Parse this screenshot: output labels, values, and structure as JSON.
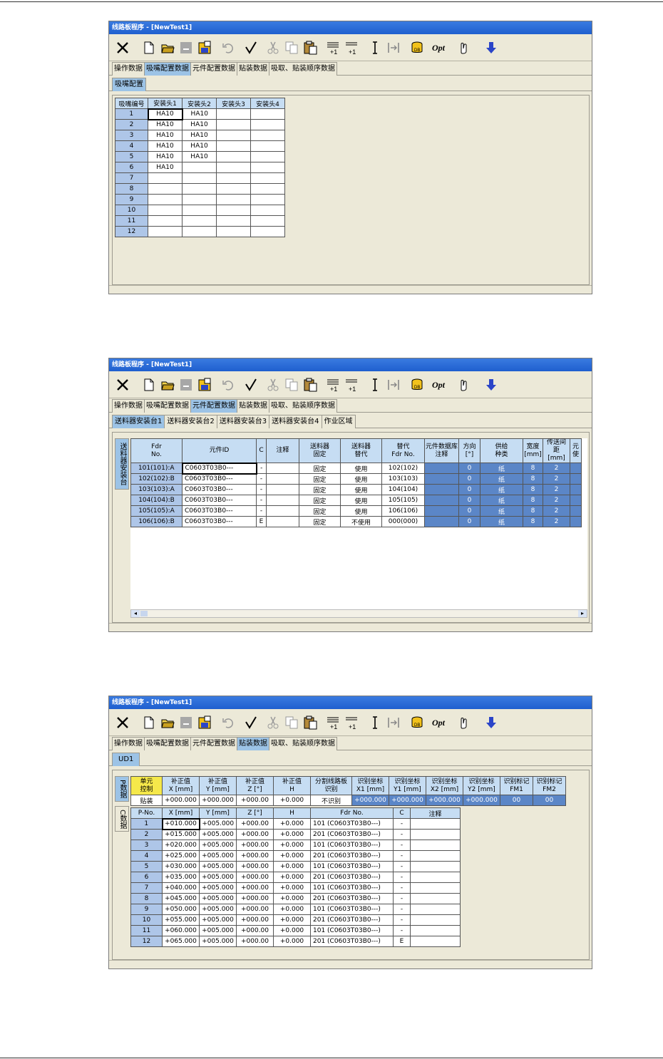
{
  "window_title": "线路板程序 - [NewTest1]",
  "main_tabs": [
    "操作数据",
    "吸嘴配置数据",
    "元件配置数据",
    "贴装数据",
    "吸取、贴装顺序数据"
  ],
  "toolbar_icons": [
    "close-icon",
    "new-file-icon",
    "open-folder-icon",
    "save-disabled-icon",
    "save-as-icon",
    "undo-icon",
    "check-icon",
    "cut-icon",
    "copy-icon",
    "paste-icon",
    "insert-row-icon",
    "append-row-icon",
    "cursor-icon",
    "jump-icon",
    "database-icon",
    "opt-icon",
    "hand-icon",
    "download-arrow-icon"
  ],
  "opt_label": "Opt",
  "plus_one": "+1",
  "colors": {
    "title_bar": "#1f5fcf",
    "selected_tab": "#9cc3e6",
    "header_cell": "#c6ddf3",
    "row_number_cell": "#aec6e8",
    "readonly_cell": "#5b86c7",
    "toolbar_arrow": "#2b45c8"
  },
  "screen1": {
    "subtab": "吸嘴配置",
    "headers": [
      "吸嘴编号",
      "安装头1",
      "安装头2",
      "安装头3",
      "安装头4"
    ],
    "rows": [
      [
        "1",
        "HA10",
        "HA10",
        "",
        ""
      ],
      [
        "2",
        "HA10",
        "HA10",
        "",
        ""
      ],
      [
        "3",
        "HA10",
        "HA10",
        "",
        ""
      ],
      [
        "4",
        "HA10",
        "HA10",
        "",
        ""
      ],
      [
        "5",
        "HA10",
        "HA10",
        "",
        ""
      ],
      [
        "6",
        "HA10",
        "",
        "",
        ""
      ],
      [
        "7",
        "",
        "",
        "",
        ""
      ],
      [
        "8",
        "",
        "",
        "",
        ""
      ],
      [
        "9",
        "",
        "",
        "",
        ""
      ],
      [
        "10",
        "",
        "",
        "",
        ""
      ],
      [
        "11",
        "",
        "",
        "",
        ""
      ],
      [
        "12",
        "",
        "",
        "",
        ""
      ]
    ]
  },
  "screen2": {
    "subtabs": [
      "送料器安装台1",
      "送料器安装台2",
      "送料器安装台3",
      "送料器安装台4",
      "作业区域"
    ],
    "vertical_tab": "送料器安装台",
    "headers": [
      "Fdr\nNo.",
      "元件ID",
      "C",
      "注释",
      "送料器\n固定",
      "送料器\n替代",
      "替代\nFdr No.",
      "元件数据库\n注释",
      "方向\n[°]",
      "供给\n种类",
      "宽度\n[mm]",
      "传送间距\n[mm]",
      "元\n使"
    ],
    "rows": [
      [
        "101(101):A",
        "C0603T03B0---",
        "-",
        "",
        "固定",
        "使用",
        "102(102)",
        "",
        "0",
        "纸",
        "8",
        "2",
        ""
      ],
      [
        "102(102):B",
        "C0603T03B0---",
        "-",
        "",
        "固定",
        "使用",
        "103(103)",
        "",
        "0",
        "纸",
        "8",
        "2",
        ""
      ],
      [
        "103(103):A",
        "C0603T03B0---",
        "-",
        "",
        "固定",
        "使用",
        "104(104)",
        "",
        "0",
        "纸",
        "8",
        "2",
        ""
      ],
      [
        "104(104):B",
        "C0603T03B0---",
        "-",
        "",
        "固定",
        "使用",
        "105(105)",
        "",
        "0",
        "纸",
        "8",
        "2",
        ""
      ],
      [
        "105(105):A",
        "C0603T03B0---",
        "-",
        "",
        "固定",
        "使用",
        "106(106)",
        "",
        "0",
        "纸",
        "8",
        "2",
        ""
      ],
      [
        "106(106):B",
        "C0603T03B0---",
        "E",
        "",
        "固定",
        "不使用",
        "000(000)",
        "",
        "0",
        "纸",
        "8",
        "2",
        ""
      ]
    ]
  },
  "screen3": {
    "subtab": "UD1",
    "p_tab": "P数据",
    "c_tab": "C数据",
    "p_headers": [
      "单元\n控制",
      "补正值\nX [mm]",
      "补正值\nY [mm]",
      "补正值\nZ [°]",
      "补正值\nH",
      "分割线路板\n识别",
      "识别坐标\nX1 [mm]",
      "识别坐标\nY1 [mm]",
      "识别坐标\nX2 [mm]",
      "识别坐标\nY2 [mm]",
      "识别标记\nFM1",
      "识别标记\nFM2"
    ],
    "p_row": [
      "贴装",
      "+000.000",
      "+000.000",
      "+000.00",
      "+0.000",
      "不识别",
      "+000.000",
      "+000.000",
      "+000.000",
      "+000.000",
      "00",
      "00"
    ],
    "c_headers": [
      "P-No.",
      "X [mm]",
      "Y [mm]",
      "Z [°]",
      "H",
      "Fdr No.",
      "C",
      "注释"
    ],
    "c_rows": [
      [
        "1",
        "+010.000",
        "+005.000",
        "+000.00",
        "+0.000",
        "101 (C0603T03B0---)",
        "-",
        ""
      ],
      [
        "2",
        "+015.000",
        "+005.000",
        "+000.00",
        "+0.000",
        "201 (C0603T03B0---)",
        "-",
        ""
      ],
      [
        "3",
        "+020.000",
        "+005.000",
        "+000.00",
        "+0.000",
        "101 (C0603T03B0---)",
        "-",
        ""
      ],
      [
        "4",
        "+025.000",
        "+005.000",
        "+000.00",
        "+0.000",
        "201 (C0603T03B0---)",
        "-",
        ""
      ],
      [
        "5",
        "+030.000",
        "+005.000",
        "+000.00",
        "+0.000",
        "101 (C0603T03B0---)",
        "-",
        ""
      ],
      [
        "6",
        "+035.000",
        "+005.000",
        "+000.00",
        "+0.000",
        "201 (C0603T03B0---)",
        "-",
        ""
      ],
      [
        "7",
        "+040.000",
        "+005.000",
        "+000.00",
        "+0.000",
        "101 (C0603T03B0---)",
        "-",
        ""
      ],
      [
        "8",
        "+045.000",
        "+005.000",
        "+000.00",
        "+0.000",
        "201 (C0603T03B0---)",
        "-",
        ""
      ],
      [
        "9",
        "+050.000",
        "+005.000",
        "+000.00",
        "+0.000",
        "101 (C0603T03B0---)",
        "-",
        ""
      ],
      [
        "10",
        "+055.000",
        "+005.000",
        "+000.00",
        "+0.000",
        "201 (C0603T03B0---)",
        "-",
        ""
      ],
      [
        "11",
        "+060.000",
        "+005.000",
        "+000.00",
        "+0.000",
        "101 (C0603T03B0---)",
        "-",
        ""
      ],
      [
        "12",
        "+065.000",
        "+005.000",
        "+000.00",
        "+0.000",
        "201 (C0603T03B0---)",
        "E",
        ""
      ]
    ]
  }
}
